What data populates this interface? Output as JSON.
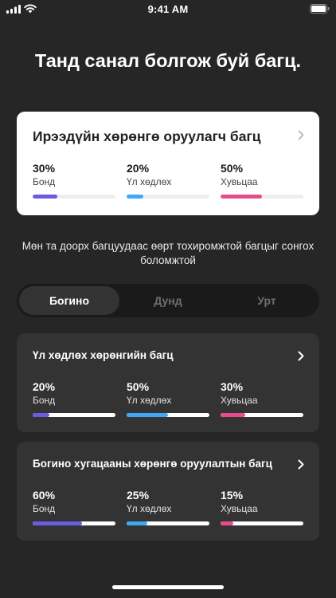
{
  "status_bar": {
    "time": "9:41 AM"
  },
  "title": "Танд санал болгож буй багц.",
  "recommended": {
    "title": "Ирээдүйн хөрөнгө оруулагч багц",
    "stats": [
      {
        "pct_label": "30%",
        "label": "Бонд",
        "value": 30,
        "color": "#6a5ce0"
      },
      {
        "pct_label": "20%",
        "label": "Үл хөдлөх",
        "value": 20,
        "color": "#3fa9f5"
      },
      {
        "pct_label": "50%",
        "label": "Хувьцаа",
        "value": 50,
        "color": "#e64d8f"
      }
    ]
  },
  "subtitle": "Мөн та доорх багцуудаас өөрт тохиромжтой багцыг сонгох боломжтой",
  "tabs": [
    {
      "label": "Богино",
      "active": true
    },
    {
      "label": "Дунд",
      "active": false
    },
    {
      "label": "Урт",
      "active": false
    }
  ],
  "portfolios": [
    {
      "title": "Үл хөдлөх хөрөнгийн багц",
      "stats": [
        {
          "pct_label": "20%",
          "label": "Бонд",
          "value": 20,
          "color": "#6a5ce0"
        },
        {
          "pct_label": "50%",
          "label": "Үл хөдлөх",
          "value": 50,
          "color": "#3fa9f5"
        },
        {
          "pct_label": "30%",
          "label": "Хувьцаа",
          "value": 30,
          "color": "#e64d8f"
        }
      ]
    },
    {
      "title": "Богино хугацааны хөрөнгө оруулалтын багц",
      "stats": [
        {
          "pct_label": "60%",
          "label": "Бонд",
          "value": 60,
          "color": "#6a5ce0"
        },
        {
          "pct_label": "25%",
          "label": "Үл хөдлөх",
          "value": 25,
          "color": "#3fa9f5"
        },
        {
          "pct_label": "15%",
          "label": "Хувьцаа",
          "value": 15,
          "color": "#e64d8f"
        }
      ]
    }
  ],
  "icons": {
    "signal": "signal-icon",
    "wifi": "wifi-icon",
    "battery": "battery-icon",
    "chevron": "chevron-right-icon"
  }
}
